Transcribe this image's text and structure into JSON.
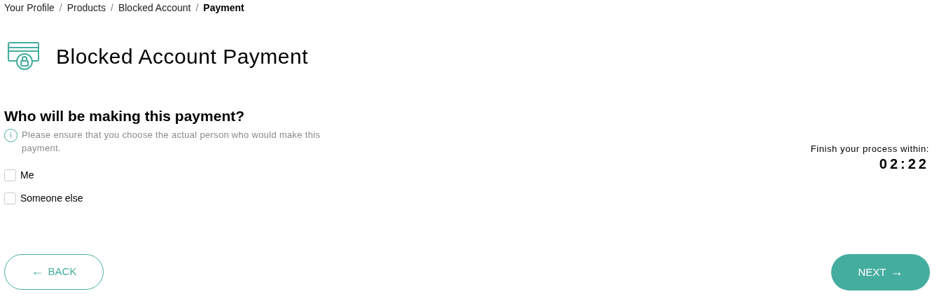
{
  "breadcrumb": [
    {
      "label": "Your Profile",
      "current": false
    },
    {
      "label": "Products",
      "current": false
    },
    {
      "label": "Blocked Account",
      "current": false
    },
    {
      "label": "Payment",
      "current": true
    }
  ],
  "separator": "/",
  "page_title": "Blocked Account Payment",
  "question": "Who will be making this payment?",
  "info_icon": "i",
  "info_text": "Please ensure that you choose the actual person who would make this payment.",
  "timer": {
    "label": "Finish your process within:",
    "value": "02:22"
  },
  "options": [
    {
      "label": "Me",
      "checked": false
    },
    {
      "label": "Someone else",
      "checked": false
    }
  ],
  "back_button": {
    "label": "BACK",
    "arrow": "←"
  },
  "next_button": {
    "label": "NEXT",
    "arrow": "→"
  }
}
